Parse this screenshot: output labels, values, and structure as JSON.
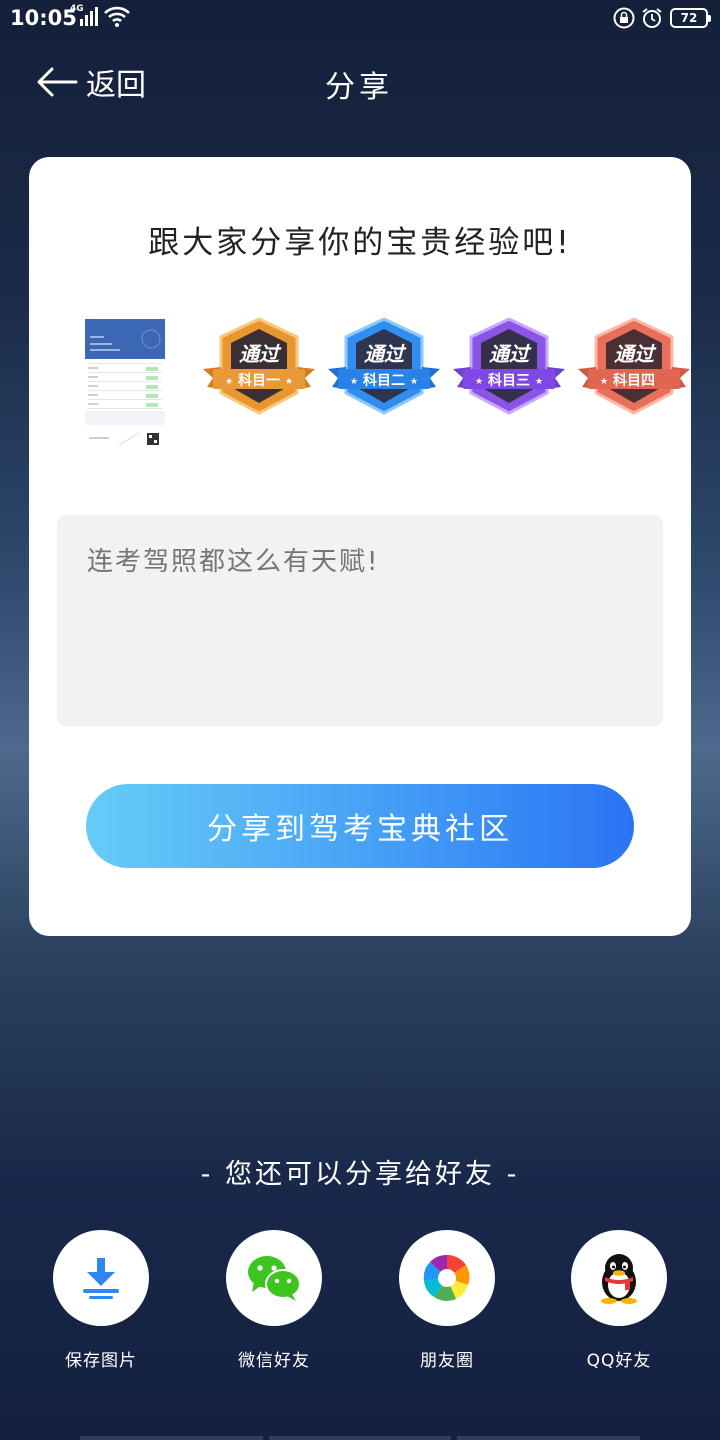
{
  "status_bar": {
    "time": "10:05",
    "network": "4G",
    "battery": "72"
  },
  "nav": {
    "back_label": "返回",
    "title": "分享"
  },
  "card": {
    "heading": "跟大家分享你的宝贵经验吧!",
    "badges": [
      {
        "top": "通过",
        "bottom": "科目一",
        "color": "#e8962e"
      },
      {
        "top": "通过",
        "bottom": "科目二",
        "color": "#2f8ef0"
      },
      {
        "top": "通过",
        "bottom": "科目三",
        "color": "#8a55e6"
      },
      {
        "top": "通过",
        "bottom": "科目四",
        "color": "#e8705a"
      }
    ],
    "message_placeholder": "连考驾照都这么有天赋!",
    "share_button_label": "分享到驾考宝典社区"
  },
  "friends": {
    "heading": "- 您还可以分享给好友 -",
    "targets": [
      {
        "label": "保存图片",
        "icon": "download-icon"
      },
      {
        "label": "微信好友",
        "icon": "wechat-icon"
      },
      {
        "label": "朋友圈",
        "icon": "moments-icon"
      },
      {
        "label": "QQ好友",
        "icon": "qq-icon"
      }
    ]
  },
  "colors": {
    "button_start": "#66ccf7",
    "button_end": "#2a74f4",
    "wechat_green": "#3cc51f"
  }
}
